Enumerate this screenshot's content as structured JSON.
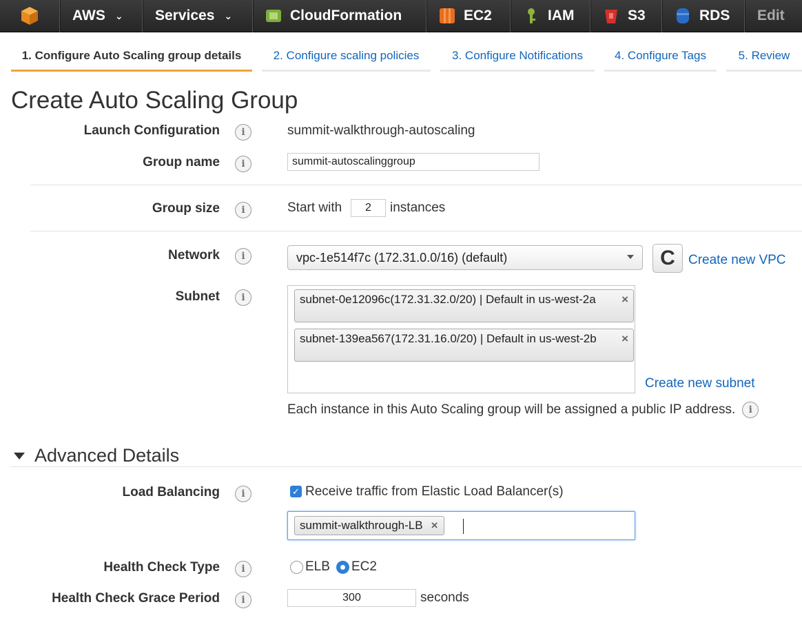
{
  "nav": {
    "account": "AWS",
    "services": "Services",
    "cloudformation": "CloudFormation",
    "ec2": "EC2",
    "iam": "IAM",
    "s3": "S3",
    "rds": "RDS",
    "edit": "Edit"
  },
  "steps": [
    {
      "label": "1. Configure Auto Scaling group details",
      "active": true
    },
    {
      "label": "2. Configure scaling policies"
    },
    {
      "label": "3. Configure Notifications"
    },
    {
      "label": "4. Configure Tags"
    },
    {
      "label": "5. Review"
    }
  ],
  "page_title": "Create Auto Scaling Group",
  "form": {
    "launch_configuration": {
      "label": "Launch Configuration",
      "value": "summit-walkthrough-autoscaling"
    },
    "group_name": {
      "label": "Group name",
      "value": "summit-autoscalinggroup"
    },
    "group_size": {
      "label": "Group size",
      "prefix": "Start with",
      "value": "2",
      "suffix": "instances"
    },
    "network": {
      "label": "Network",
      "value": "vpc-1e514f7c (172.31.0.0/16) (default)",
      "create_link": "Create new VPC"
    },
    "subnet": {
      "label": "Subnet",
      "tokens": [
        "subnet-0e12096c(172.31.32.0/20) | Default in us-west-2a",
        "subnet-139ea567(172.31.16.0/20) | Default in us-west-2b"
      ],
      "create_link": "Create new subnet",
      "note": "Each instance in this Auto Scaling group will be assigned a public IP address."
    }
  },
  "advanced": {
    "title": "Advanced Details",
    "load_balancing": {
      "label": "Load Balancing",
      "checkbox_label": "Receive traffic from Elastic Load Balancer(s)",
      "checked": true,
      "token": "summit-walkthrough-LB"
    },
    "health_check_type": {
      "label": "Health Check Type",
      "options": [
        "ELB",
        "EC2"
      ],
      "selected": "EC2"
    },
    "grace_period": {
      "label": "Health Check Grace Period",
      "value": "300",
      "suffix": "seconds"
    }
  },
  "icons": {
    "info": "i",
    "refresh": "C",
    "remove": "×",
    "check": "✓"
  }
}
